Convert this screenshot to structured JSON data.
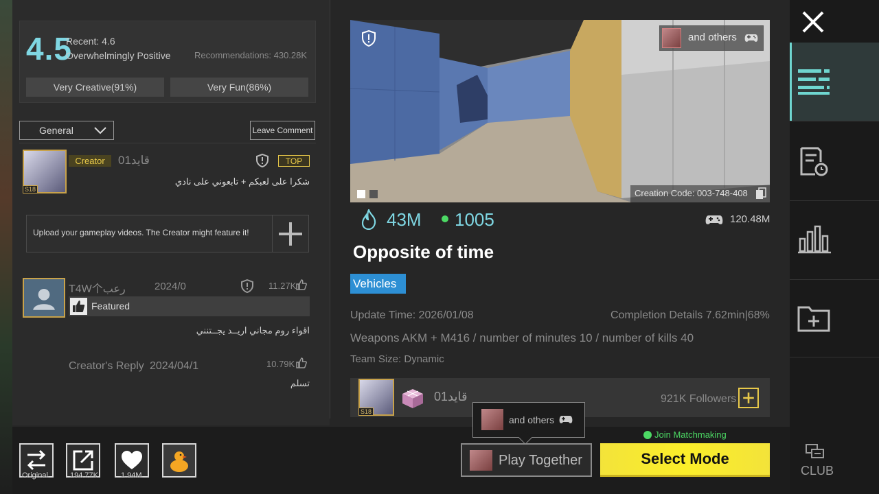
{
  "rating": {
    "score": "4.5",
    "recent": "Recent: 4.6",
    "summary": "Overwhelmingly Positive",
    "recommendations": "Recommendations: 430.28K",
    "tags": [
      "Very Creative(91%)",
      "Very Fun(86%)"
    ]
  },
  "comments_toolbar": {
    "filter_selected": "General",
    "leave_comment": "Leave Comment"
  },
  "comments": [
    {
      "creator_badge": "Creator",
      "name": "قايد01",
      "level": "S18",
      "top_badge": "TOP",
      "text": "شكرا على لعبكم + تابعوني على نادي"
    },
    {
      "name": "T4W个رعب",
      "date": "2024/0",
      "likes": "11.27K",
      "featured": "Featured",
      "text": "اقواء روم مجاني اريــد يجــتنني",
      "reply_label": "Creator's Reply",
      "reply_date": "2024/04/1",
      "reply_likes": "10.79K",
      "reply_text": "تسلم"
    }
  ],
  "upload_prompt": "Upload your gameplay videos. The Creator might feature it!",
  "preview": {
    "others": "and others",
    "creation_code": "Creation Code: 003-748-408"
  },
  "stats": {
    "plays": "43M",
    "online": "1005",
    "total_games": "120.48M"
  },
  "map": {
    "title": "Opposite of time",
    "tag": "Vehicles",
    "update_time": "Update Time: 2026/01/08",
    "completion": "Completion Details   7.62min|68%",
    "description": "Weapons AKM + M416 / number of minutes 10 / number of kills 40",
    "team_size": "Team Size: Dynamic"
  },
  "creator": {
    "name": "قايد01",
    "level": "S18",
    "followers": "921K Followers"
  },
  "bottom": {
    "original": "Original",
    "shares": "194.77K",
    "likes": "1.94M",
    "tooltip_others": "and others",
    "play_together": "Play Together",
    "join_matchmaking": "Join Matchmaking",
    "select_mode": "Select Mode"
  },
  "sidebar": {
    "club": "CLUB"
  },
  "colors": {
    "accent": "#7fd7e3",
    "gold": "#e8c94a",
    "tag_blue": "#2d8fd4",
    "select_yellow": "#f3e33a",
    "online_green": "#4cd964"
  }
}
